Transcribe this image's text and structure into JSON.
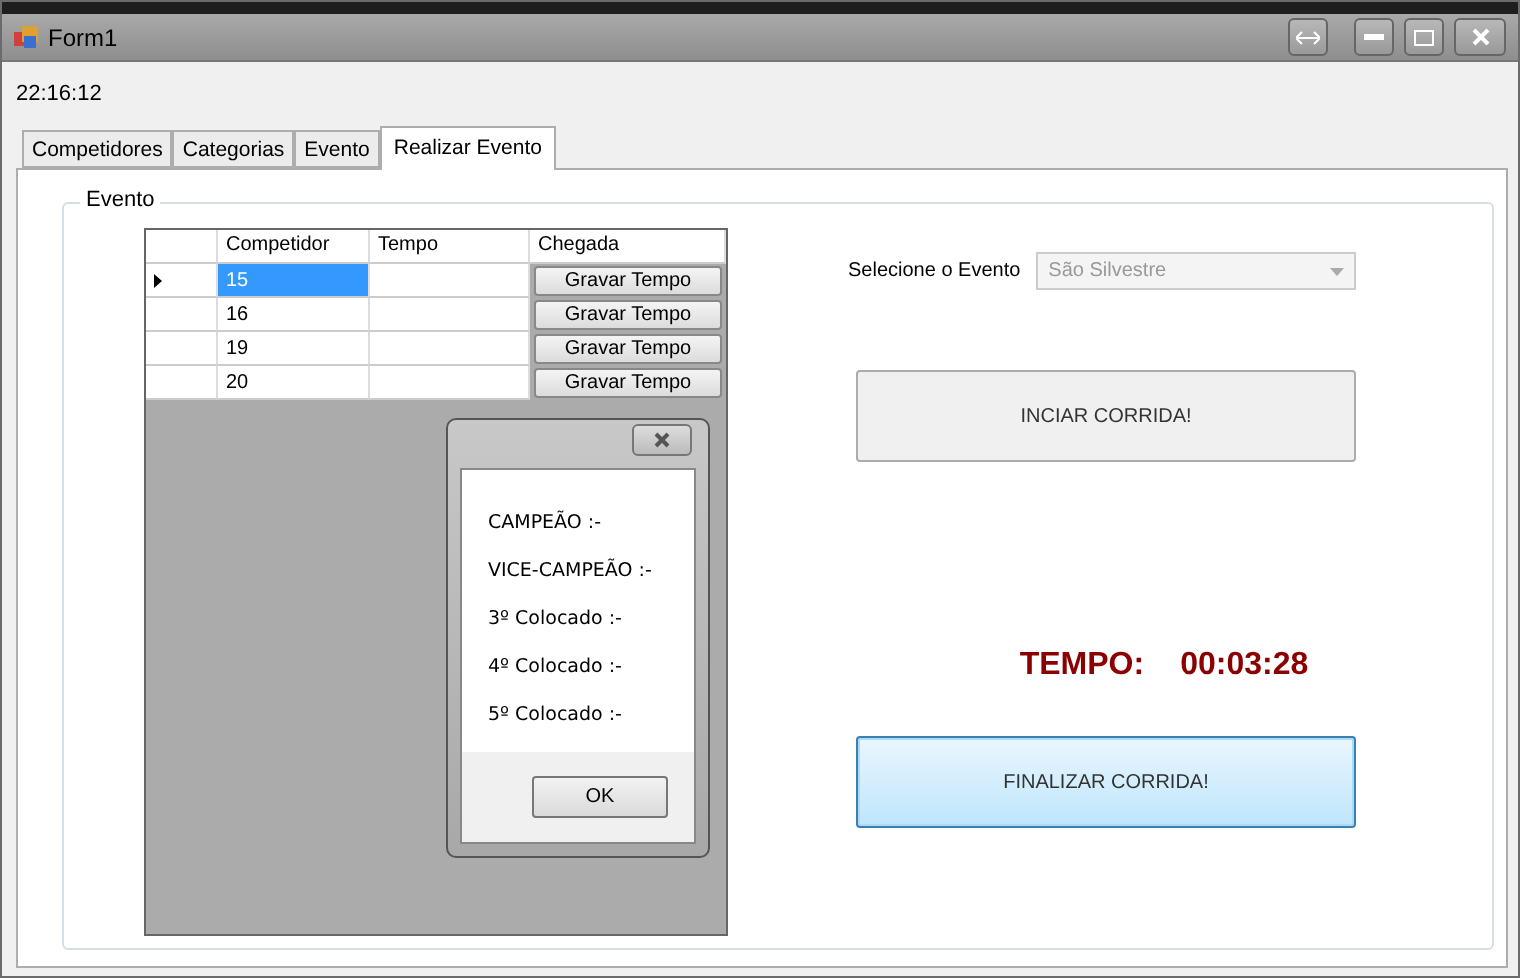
{
  "window": {
    "title": "Form1"
  },
  "clock": "22:16:12",
  "tabs": [
    {
      "label": "Competidores",
      "selected": false
    },
    {
      "label": "Categorias",
      "selected": false
    },
    {
      "label": "Evento",
      "selected": false
    },
    {
      "label": "Realizar Evento",
      "selected": true
    }
  ],
  "group": {
    "title": "Evento"
  },
  "grid": {
    "columns": [
      "Competidor",
      "Tempo",
      "Chegada"
    ],
    "rows": [
      {
        "competidor": "15",
        "button": "Gravar Tempo",
        "selected": true
      },
      {
        "competidor": "16",
        "button": "Gravar Tempo",
        "selected": false
      },
      {
        "competidor": "19",
        "button": "Gravar Tempo",
        "selected": false
      },
      {
        "competidor": "20",
        "button": "Gravar Tempo",
        "selected": false
      }
    ]
  },
  "dialog": {
    "lines": [
      "CAMPEÃO :-",
      "VICE-CAMPEÃO :-",
      "3º Colocado :-",
      "4º Colocado :-",
      "5º Colocado :-"
    ],
    "button": "OK"
  },
  "event_select": {
    "label": "Selecione o Evento",
    "value": "São Silvestre",
    "disabled": true
  },
  "start_button": {
    "label": "INCIAR CORRIDA!",
    "focused": false
  },
  "timer": {
    "label": "TEMPO:",
    "value": "00:03:28"
  },
  "finish_button": {
    "label": "FINALIZAR CORRIDA!",
    "focused": true
  }
}
